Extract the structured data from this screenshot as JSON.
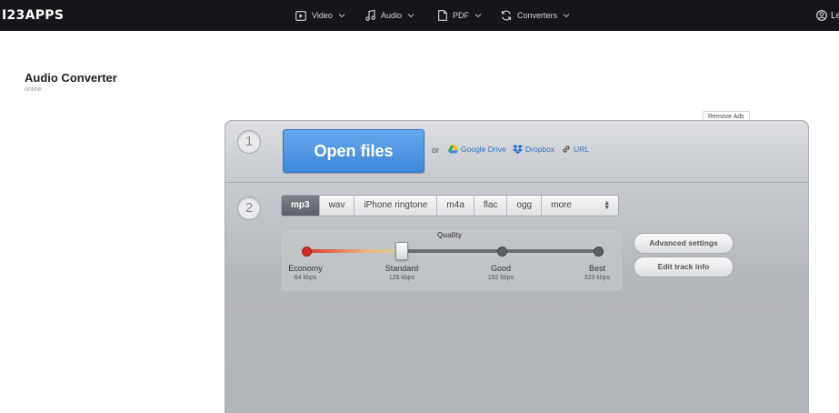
{
  "nav": {
    "logo": "I23APPS",
    "items": [
      {
        "label": "Video",
        "icon": "video-icon"
      },
      {
        "label": "Audio",
        "icon": "music-icon"
      },
      {
        "label": "PDF",
        "icon": "document-icon"
      },
      {
        "label": "Converters",
        "icon": "refresh-icon"
      }
    ],
    "user_label": "Le"
  },
  "page": {
    "title": "Audio Converter",
    "subtitle": "online"
  },
  "remove_ads": "Remove Ads",
  "step1": {
    "number": "1",
    "open_files": "Open files",
    "or": "or",
    "sources": [
      {
        "label": "Google Drive",
        "icon": "google-drive-icon"
      },
      {
        "label": "Dropbox",
        "icon": "dropbox-icon"
      },
      {
        "label": "URL",
        "icon": "link-icon"
      }
    ]
  },
  "step2": {
    "number": "2",
    "formats": [
      "mp3",
      "wav",
      "iPhone ringtone",
      "m4a",
      "flac",
      "ogg",
      "more"
    ],
    "selected_format": "mp3",
    "quality": {
      "label": "Quality",
      "levels": [
        {
          "name": "Economy",
          "bitrate": "64 kbps"
        },
        {
          "name": "Standard",
          "bitrate": "128 kbps"
        },
        {
          "name": "Good",
          "bitrate": "192 kbps"
        },
        {
          "name": "Best",
          "bitrate": "320 kbps"
        }
      ],
      "selected": "Standard"
    },
    "advanced_settings": "Advanced settings",
    "edit_track_info": "Edit track info"
  },
  "colors": {
    "topbar": "#15161a",
    "accent_blue": "#3f87d9",
    "link_blue": "#2f6fc0",
    "panel": "#b9bcc1",
    "slider_red": "#cf2f28"
  }
}
